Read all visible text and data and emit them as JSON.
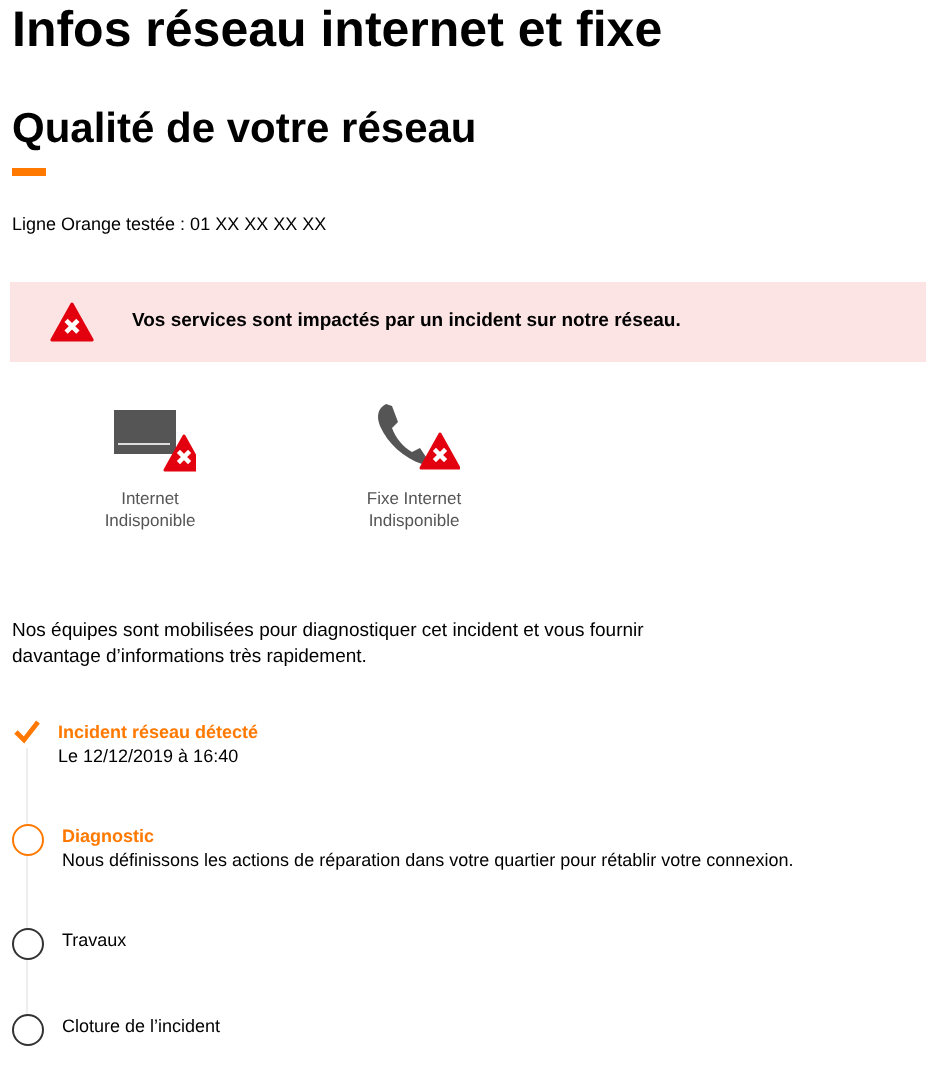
{
  "title": "Infos réseau internet et fixe",
  "subtitle": "Qualité de votre réseau",
  "line_tested": "Ligne Orange testée : 01 XX XX XX XX",
  "alert": {
    "message": "Vos services sont impactés par un incident sur notre réseau."
  },
  "services": [
    {
      "kind": "internet",
      "label": [
        "Internet",
        "Indisponible"
      ]
    },
    {
      "kind": "phone",
      "label": [
        "Fixe Internet",
        "Indisponible"
      ]
    }
  ],
  "intro": "Nos équipes sont mobilisées pour diagnostiquer cet incident et vous fournir davantage d’informations très rapidement.",
  "steps": [
    {
      "completed": true,
      "in_progress": false,
      "title": "Incident réseau détecté",
      "detail": "Le 12/12/2019 à 16:40"
    },
    {
      "completed": false,
      "in_progress": true,
      "title": "Diagnostic",
      "detail": "Nous définissons les actions de réparation dans votre quartier pour rétablir votre connexion."
    },
    {
      "completed": false,
      "in_progress": false,
      "title": "Travaux"
    },
    {
      "completed": false,
      "in_progress": false,
      "title": "Cloture de l’incident"
    }
  ]
}
